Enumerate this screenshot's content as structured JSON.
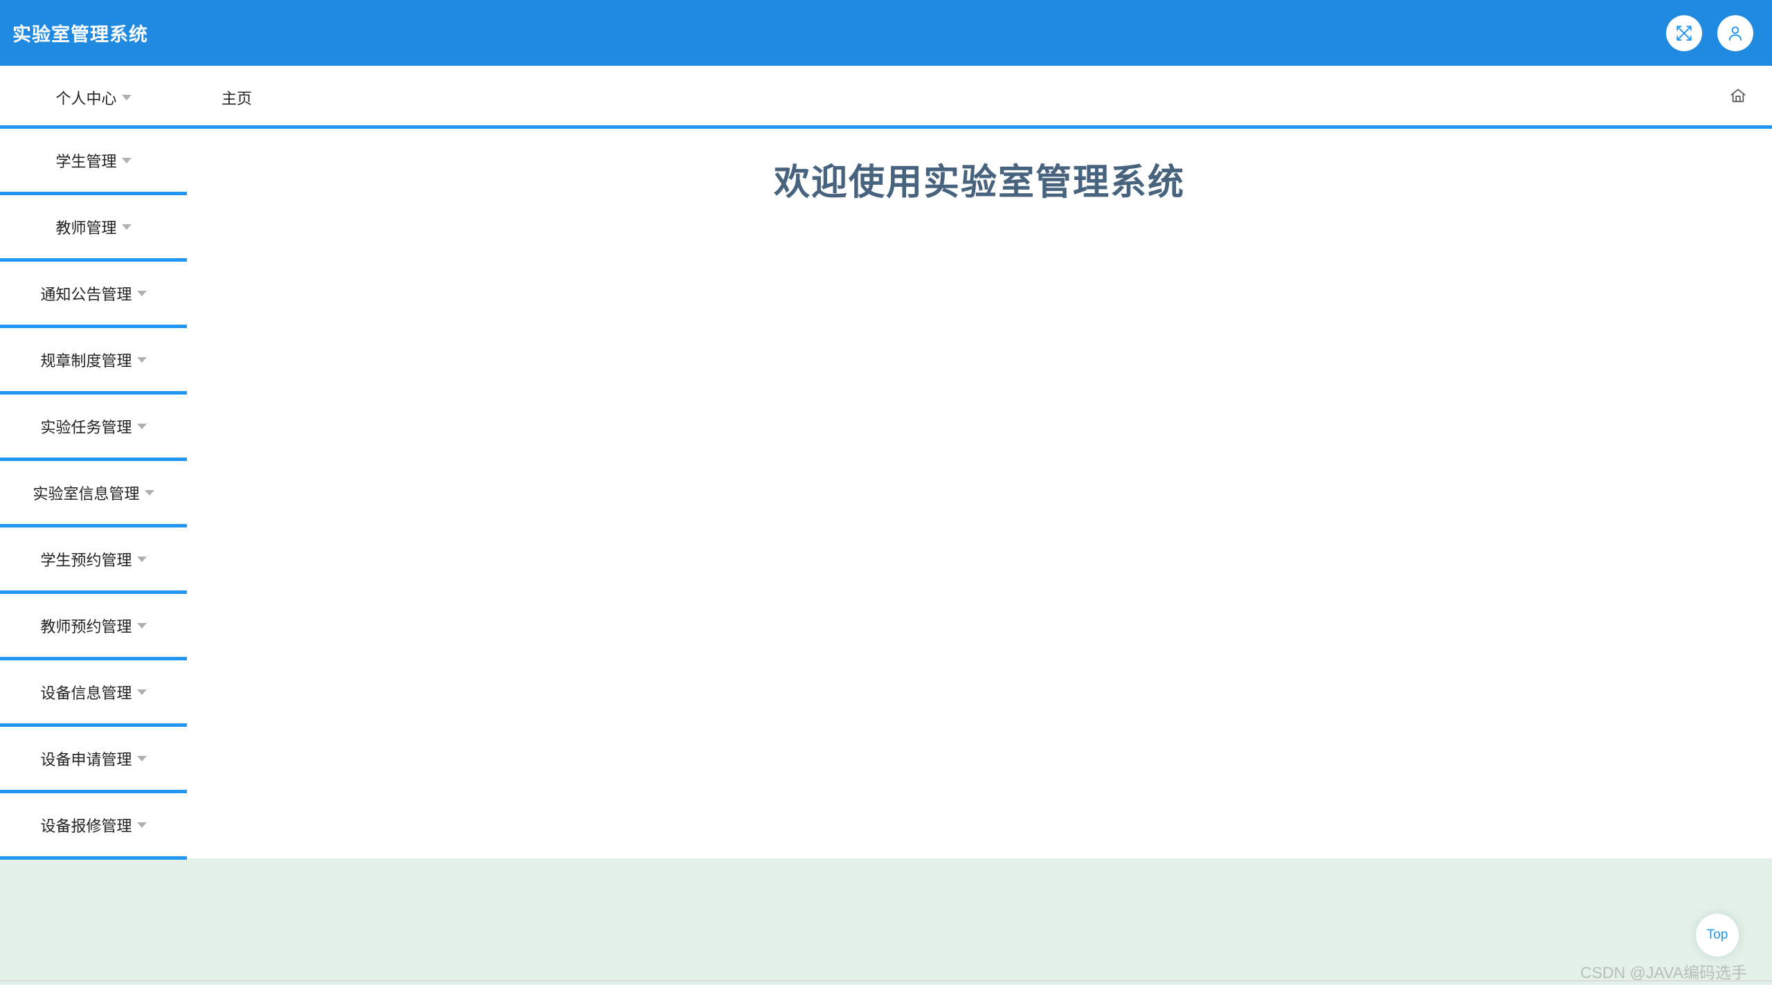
{
  "header": {
    "title": "实验室管理系统",
    "brand_color": "#1f8ae0",
    "actions": [
      {
        "name": "fullscreen-icon",
        "label": "全屏"
      },
      {
        "name": "user-avatar-icon",
        "label": "用户"
      }
    ]
  },
  "navbar": {
    "user_menu": "个人中心",
    "tabs": [
      {
        "label": "主页",
        "active": true
      }
    ],
    "home_icon": "home-icon"
  },
  "sidebar": {
    "items": [
      {
        "label": "学生管理"
      },
      {
        "label": "教师管理"
      },
      {
        "label": "通知公告管理"
      },
      {
        "label": "规章制度管理"
      },
      {
        "label": "实验任务管理"
      },
      {
        "label": "实验室信息管理"
      },
      {
        "label": "学生预约管理"
      },
      {
        "label": "教师预约管理"
      },
      {
        "label": "设备信息管理"
      },
      {
        "label": "设备申请管理"
      },
      {
        "label": "设备报修管理"
      }
    ],
    "divider_color": "#2196f3"
  },
  "main": {
    "welcome_heading": "欢迎使用实验室管理系统",
    "heading_color": "#47637d"
  },
  "footer": {
    "background_color": "#e3f1ea",
    "top_button_label": "Top",
    "watermark": "CSDN @JAVA编码选手"
  }
}
